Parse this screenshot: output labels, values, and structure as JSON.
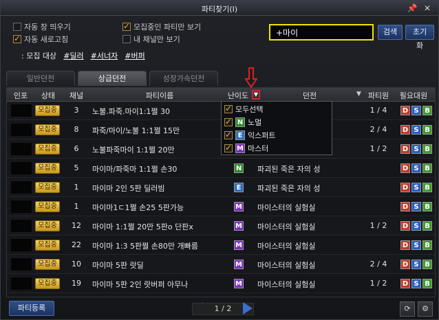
{
  "window": {
    "title": "파티찾기(I)"
  },
  "options": {
    "auto_popup": "자동 창 띄우기",
    "auto_refresh": "자동 새로고침",
    "recruiting_only": "모집중인 파티만 보기",
    "my_channel_only": "내 채널만 보기",
    "checked": {
      "auto_popup": false,
      "auto_refresh": true,
      "recruiting_only": true,
      "my_channel_only": false
    }
  },
  "search": {
    "value": "+마이",
    "search_button": "검색",
    "reset_button": "초기화"
  },
  "recruit": {
    "label": ": 모집 대상",
    "tags": [
      "#딜러",
      "#서너자",
      "#버퍼"
    ]
  },
  "tabs": [
    "일반던전",
    "상급던전",
    "성장가속던전"
  ],
  "table": {
    "headers": [
      "인포",
      "상태",
      "채널",
      "파티이름",
      "난이도",
      "던전",
      "파티원",
      "필요대원"
    ],
    "rows": [
      {
        "status": "모집중",
        "channel": "3",
        "name": "노불.파죽.마이1:1쩔 30",
        "difficulty": "",
        "dungeon": "",
        "members": "1 / 4"
      },
      {
        "status": "모집중",
        "channel": "8",
        "name": "파죽/마이/노불 1:1쩔 15만",
        "difficulty": "",
        "dungeon": "크",
        "members": "2 / 4"
      },
      {
        "status": "모집중",
        "channel": "6",
        "name": "노불파죽마이 1:1쩔 20만",
        "difficulty": "",
        "dungeon": "크",
        "members": "1 / 2"
      },
      {
        "status": "모집중",
        "channel": "5",
        "name": "마이마/파죽마 1:1쩔 손30",
        "difficulty": "N",
        "dungeon": "파괴된 죽은 자의 성",
        "members": ""
      },
      {
        "status": "모집중",
        "channel": "1",
        "name": "마이마 2인 5판 딜러빔",
        "difficulty": "E",
        "dungeon": "파괴된 죽은 자의 성",
        "members": ""
      },
      {
        "status": "모집중",
        "channel": "1",
        "name": "마이마1ㄷ1쩔 손25 5판가능",
        "difficulty": "M",
        "dungeon": "마이스터의 실험실",
        "members": ""
      },
      {
        "status": "모집중",
        "channel": "12",
        "name": "마이마 1:1쩔 20만 5판o 단판x",
        "difficulty": "M",
        "dungeon": "마이스터의 실험실",
        "members": "1 / 2"
      },
      {
        "status": "모집중",
        "channel": "22",
        "name": "마이마 1:3 5판쩔 손80만 개빠름",
        "difficulty": "M",
        "dungeon": "마이스터의 실험실",
        "members": ""
      },
      {
        "status": "모집중",
        "channel": "10",
        "name": "마이마 5판 랏딜",
        "difficulty": "M",
        "dungeon": "마이스터의 실험실",
        "members": "2 / 4"
      },
      {
        "status": "모집중",
        "channel": "19",
        "name": "마이마 5판 2인 랏버퍼 아무나",
        "difficulty": "M",
        "dungeon": "마이스터의 실험실",
        "members": "1 / 2"
      }
    ]
  },
  "dropdown": {
    "select_all": "모두선택",
    "items": [
      {
        "code": "N",
        "label": "노멀"
      },
      {
        "code": "E",
        "label": "익스퍼트"
      },
      {
        "code": "M",
        "label": "마스터"
      }
    ]
  },
  "bottom": {
    "register_button": "파티등록",
    "page": "1 / 2"
  },
  "colors": {
    "search_border": "#f2e600",
    "badge": "#f0c040",
    "normal": "#2d8a2d",
    "expert": "#2b6fbf",
    "master": "#7a2fbf",
    "annotation_arrow": "#e02020"
  }
}
